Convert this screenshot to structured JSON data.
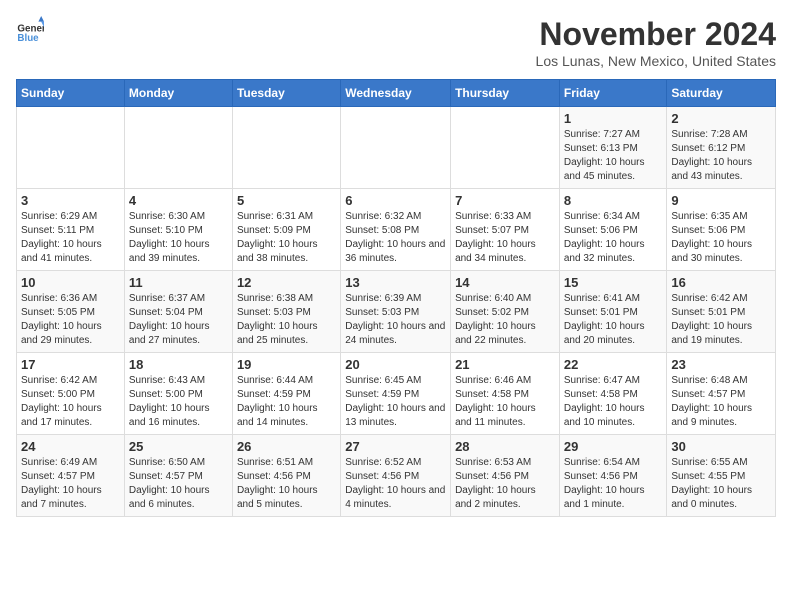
{
  "header": {
    "logo_general": "General",
    "logo_blue": "Blue",
    "month_title": "November 2024",
    "location": "Los Lunas, New Mexico, United States"
  },
  "days_of_week": [
    "Sunday",
    "Monday",
    "Tuesday",
    "Wednesday",
    "Thursday",
    "Friday",
    "Saturday"
  ],
  "weeks": [
    [
      {
        "day": "",
        "info": ""
      },
      {
        "day": "",
        "info": ""
      },
      {
        "day": "",
        "info": ""
      },
      {
        "day": "",
        "info": ""
      },
      {
        "day": "",
        "info": ""
      },
      {
        "day": "1",
        "info": "Sunrise: 7:27 AM\nSunset: 6:13 PM\nDaylight: 10 hours and 45 minutes."
      },
      {
        "day": "2",
        "info": "Sunrise: 7:28 AM\nSunset: 6:12 PM\nDaylight: 10 hours and 43 minutes."
      }
    ],
    [
      {
        "day": "3",
        "info": "Sunrise: 6:29 AM\nSunset: 5:11 PM\nDaylight: 10 hours and 41 minutes."
      },
      {
        "day": "4",
        "info": "Sunrise: 6:30 AM\nSunset: 5:10 PM\nDaylight: 10 hours and 39 minutes."
      },
      {
        "day": "5",
        "info": "Sunrise: 6:31 AM\nSunset: 5:09 PM\nDaylight: 10 hours and 38 minutes."
      },
      {
        "day": "6",
        "info": "Sunrise: 6:32 AM\nSunset: 5:08 PM\nDaylight: 10 hours and 36 minutes."
      },
      {
        "day": "7",
        "info": "Sunrise: 6:33 AM\nSunset: 5:07 PM\nDaylight: 10 hours and 34 minutes."
      },
      {
        "day": "8",
        "info": "Sunrise: 6:34 AM\nSunset: 5:06 PM\nDaylight: 10 hours and 32 minutes."
      },
      {
        "day": "9",
        "info": "Sunrise: 6:35 AM\nSunset: 5:06 PM\nDaylight: 10 hours and 30 minutes."
      }
    ],
    [
      {
        "day": "10",
        "info": "Sunrise: 6:36 AM\nSunset: 5:05 PM\nDaylight: 10 hours and 29 minutes."
      },
      {
        "day": "11",
        "info": "Sunrise: 6:37 AM\nSunset: 5:04 PM\nDaylight: 10 hours and 27 minutes."
      },
      {
        "day": "12",
        "info": "Sunrise: 6:38 AM\nSunset: 5:03 PM\nDaylight: 10 hours and 25 minutes."
      },
      {
        "day": "13",
        "info": "Sunrise: 6:39 AM\nSunset: 5:03 PM\nDaylight: 10 hours and 24 minutes."
      },
      {
        "day": "14",
        "info": "Sunrise: 6:40 AM\nSunset: 5:02 PM\nDaylight: 10 hours and 22 minutes."
      },
      {
        "day": "15",
        "info": "Sunrise: 6:41 AM\nSunset: 5:01 PM\nDaylight: 10 hours and 20 minutes."
      },
      {
        "day": "16",
        "info": "Sunrise: 6:42 AM\nSunset: 5:01 PM\nDaylight: 10 hours and 19 minutes."
      }
    ],
    [
      {
        "day": "17",
        "info": "Sunrise: 6:42 AM\nSunset: 5:00 PM\nDaylight: 10 hours and 17 minutes."
      },
      {
        "day": "18",
        "info": "Sunrise: 6:43 AM\nSunset: 5:00 PM\nDaylight: 10 hours and 16 minutes."
      },
      {
        "day": "19",
        "info": "Sunrise: 6:44 AM\nSunset: 4:59 PM\nDaylight: 10 hours and 14 minutes."
      },
      {
        "day": "20",
        "info": "Sunrise: 6:45 AM\nSunset: 4:59 PM\nDaylight: 10 hours and 13 minutes."
      },
      {
        "day": "21",
        "info": "Sunrise: 6:46 AM\nSunset: 4:58 PM\nDaylight: 10 hours and 11 minutes."
      },
      {
        "day": "22",
        "info": "Sunrise: 6:47 AM\nSunset: 4:58 PM\nDaylight: 10 hours and 10 minutes."
      },
      {
        "day": "23",
        "info": "Sunrise: 6:48 AM\nSunset: 4:57 PM\nDaylight: 10 hours and 9 minutes."
      }
    ],
    [
      {
        "day": "24",
        "info": "Sunrise: 6:49 AM\nSunset: 4:57 PM\nDaylight: 10 hours and 7 minutes."
      },
      {
        "day": "25",
        "info": "Sunrise: 6:50 AM\nSunset: 4:57 PM\nDaylight: 10 hours and 6 minutes."
      },
      {
        "day": "26",
        "info": "Sunrise: 6:51 AM\nSunset: 4:56 PM\nDaylight: 10 hours and 5 minutes."
      },
      {
        "day": "27",
        "info": "Sunrise: 6:52 AM\nSunset: 4:56 PM\nDaylight: 10 hours and 4 minutes."
      },
      {
        "day": "28",
        "info": "Sunrise: 6:53 AM\nSunset: 4:56 PM\nDaylight: 10 hours and 2 minutes."
      },
      {
        "day": "29",
        "info": "Sunrise: 6:54 AM\nSunset: 4:56 PM\nDaylight: 10 hours and 1 minute."
      },
      {
        "day": "30",
        "info": "Sunrise: 6:55 AM\nSunset: 4:55 PM\nDaylight: 10 hours and 0 minutes."
      }
    ]
  ]
}
